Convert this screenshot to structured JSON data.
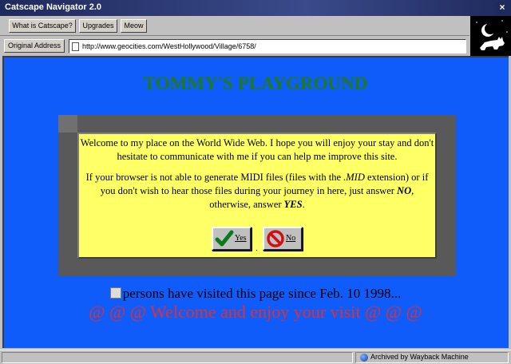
{
  "window": {
    "title": "Catscape Navigator 2.0",
    "close_glyph": "×"
  },
  "toolbar": {
    "buttons": [
      {
        "label": "What is Catscape?"
      },
      {
        "label": "Upgrades"
      },
      {
        "label": "Meow"
      }
    ]
  },
  "address": {
    "label": "Original Address",
    "url": "http://www.geocities.com/WestHollywood/Village/6758/"
  },
  "page": {
    "title": "TOMMY'S PLAYGROUND",
    "message_p1": "Welcome to my place on the World Wide Web. I hope you will enjoy your stay and don't hesitate to communicate with me if you can help me improve this site.",
    "message_p2_a": "If your browser is not able to generate MIDI files (files with the ",
    "message_p2_mid": ".MID",
    "message_p2_b": " extension) or if you don't wish to hear those files during your journey in here, just answer ",
    "message_p2_no": "NO",
    "message_p2_c": ", otherwise, answer ",
    "message_p2_yes": "YES",
    "message_p2_d": ".",
    "yes_button": "Yes",
    "no_button": "No",
    "dot": ".",
    "visits_text": "persons have visited this page since Feb. 10 1998...",
    "welcome_text": "@ @ @ Welcome and enjoy your visit @ @ @"
  },
  "status": {
    "text": "Archived by Wayback Machine"
  },
  "colors": {
    "page_background": "#0f5cfa",
    "title_green": "#1e7a1e",
    "welcome_red": "#e03030",
    "message_yellow": "#ffff66"
  }
}
